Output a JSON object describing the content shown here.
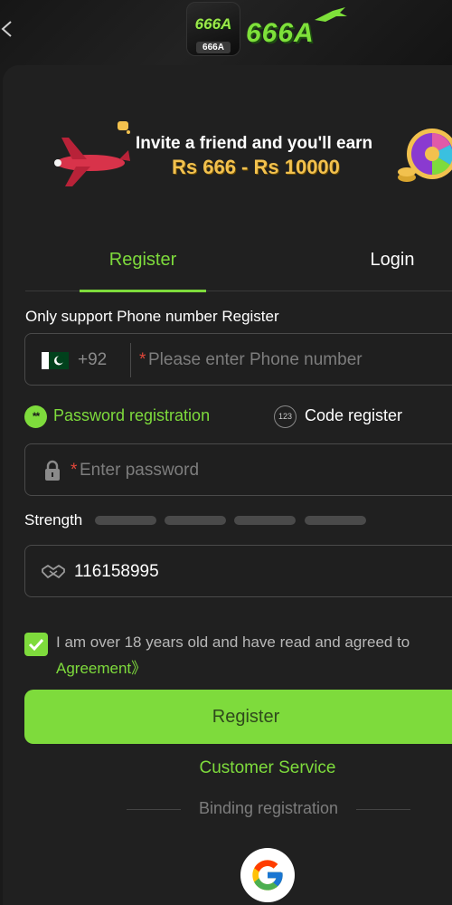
{
  "header": {
    "back_icon": "chevron-left-icon",
    "logo_badge_text": "666A",
    "logo_badge_sub": "666A",
    "logo_text": "666A"
  },
  "banner": {
    "line1": "Invite a friend and you'll earn",
    "line2": "Rs 666 - Rs 10000"
  },
  "tabs": {
    "register": "Register",
    "login": "Login",
    "active": "register"
  },
  "form": {
    "only_support": "Only support Phone number Register",
    "phone": {
      "dial_code": "+92",
      "required_mark": "*",
      "placeholder": "Please enter Phone number"
    },
    "modes": {
      "password_registration": "Password registration",
      "password_icon_text": "**",
      "code_register": "Code register",
      "code_icon_text": "123"
    },
    "password": {
      "required_mark": "*",
      "placeholder": "Enter password"
    },
    "strength": {
      "label": "Strength",
      "level": 0,
      "segments": 4
    },
    "invite_code": "116158995",
    "agreement": {
      "checked": true,
      "text": "I am over 18 years old and have read and agreed to",
      "link": "Agreement》"
    },
    "register_button": "Register",
    "customer_service": "Customer Service",
    "binding_label": "Binding registration"
  },
  "colors": {
    "accent": "#7edb3c",
    "background": "#1a1a1a",
    "panel": "#202020",
    "required": "#e0463a",
    "banner_amount": "#f2c14e"
  }
}
